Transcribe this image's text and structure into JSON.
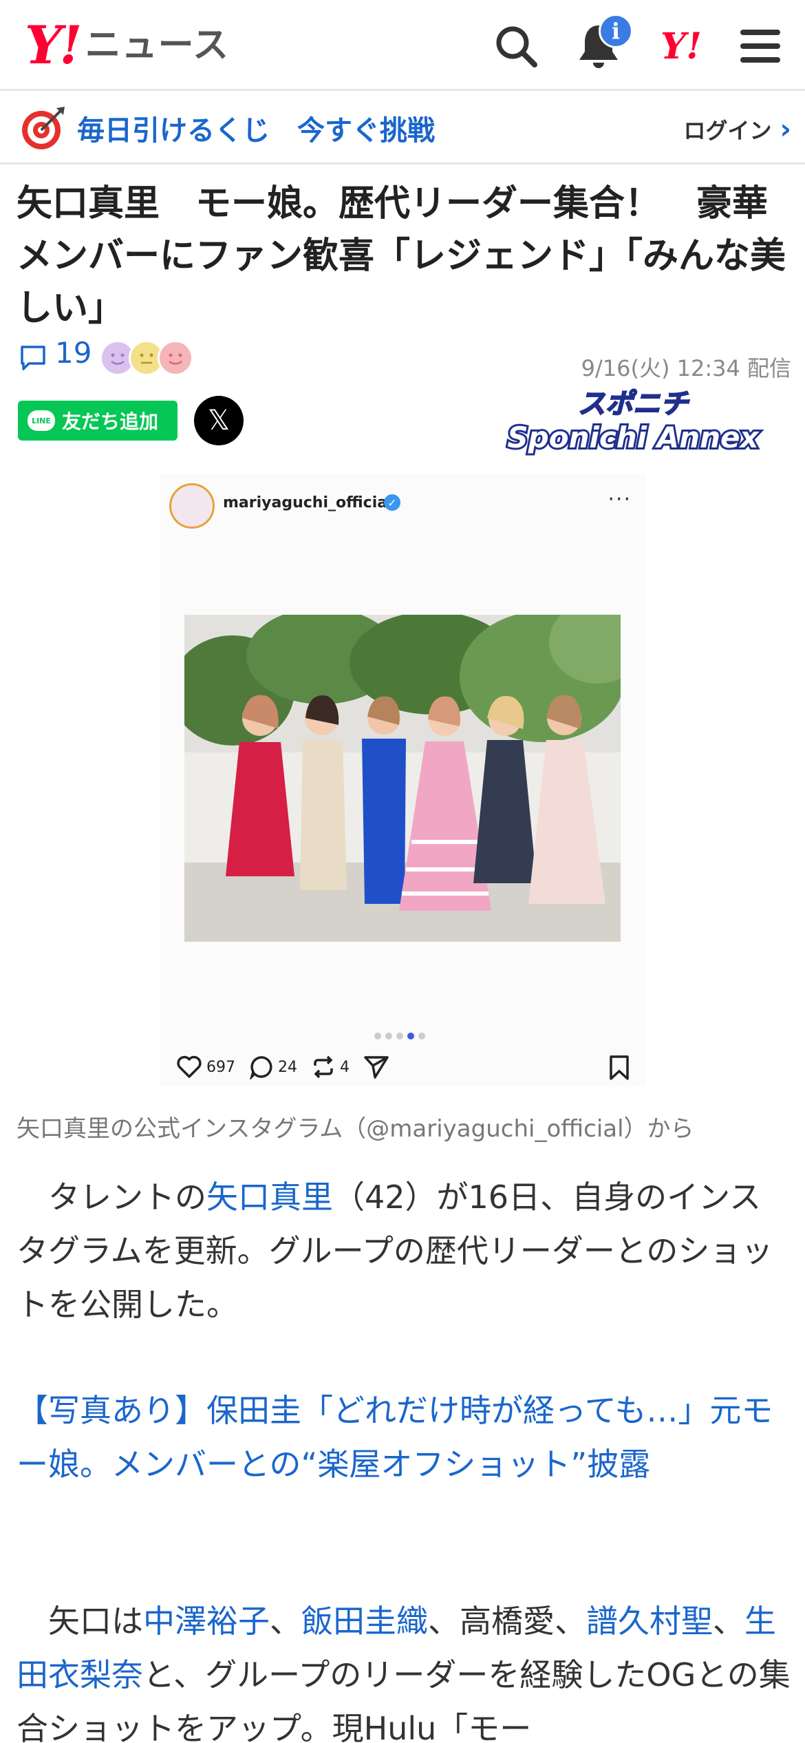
{
  "header": {
    "logo_mark": "Y!",
    "logo_text": "ニュース",
    "notification_badge": "i",
    "yahoo_mark": "Y!"
  },
  "promo": {
    "text": "毎日引けるくじ　今すぐ挑戦",
    "login": "ログイン"
  },
  "article": {
    "title": "矢口真里　モー娘。歴代リーダー集合！　豪華メンバーにファン歓喜「レジェンド」「みんな美しい」",
    "comment_count": "19",
    "date": "9/16(火) 12:34 配信",
    "line_button": "友だち追加",
    "line_logo": "LINE",
    "x_button": "𝕏",
    "source_logo": "スポニチ Sponichi Annex",
    "source_top": "スポニチ",
    "source_bottom": "Sponichi Annex"
  },
  "embed": {
    "username": "mariyaguchi_official",
    "more": "···",
    "likes": "697",
    "comments": "24",
    "reposts": "4"
  },
  "caption": "矢口真里の公式インスタグラム（@mariyaguchi_official）から",
  "body": {
    "p1_prefix": "　タレントの",
    "p1_link": "矢口真里",
    "p1_rest": "（42）が16日、自身のインスタグラムを更新。グループの歴代リーダーとのショットを公開した。",
    "p2_link": "【写真あり】保田圭「どれだけ時が経っても…」元モー娘。メンバーとの“楽屋オフショット”披露",
    "p3_a": "　矢口は",
    "p3_l1": "中澤裕子",
    "p3_b": "、",
    "p3_l2": "飯田圭織",
    "p3_c": "、高橋愛、",
    "p3_l3": "譜久村聖",
    "p3_d": "、",
    "p3_l4": "生田衣梨奈",
    "p3_e": "と、グループのリーダーを経験したOGとの集合ショットをアップ。現Hulu「モー"
  },
  "colors": {
    "brand_red": "#ff0033",
    "link_blue": "#1a66cc",
    "line_green": "#06c755"
  },
  "icons": [
    "search-icon",
    "bell-icon",
    "menu-icon",
    "target-icon",
    "chevron-right-icon",
    "comment-icon",
    "heart-icon",
    "repost-icon",
    "send-icon",
    "bookmark-icon"
  ]
}
